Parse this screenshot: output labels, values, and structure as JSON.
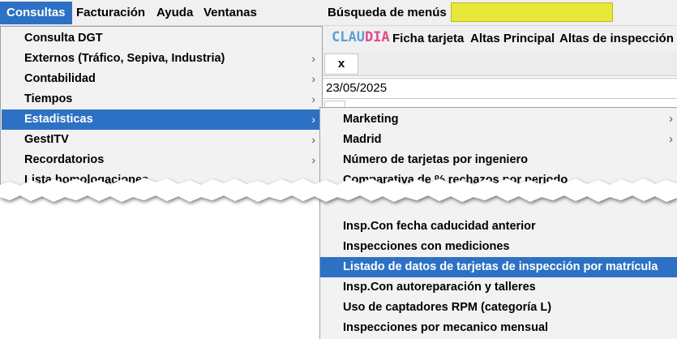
{
  "menubar": {
    "items": [
      "Consultas",
      "Facturación",
      "Ayuda",
      "Ventanas"
    ],
    "search_label": "Búsqueda de menús",
    "search_value": ""
  },
  "toolbar": {
    "logo_part1": "CLAU",
    "logo_part2": "DIA",
    "items": [
      "Ficha tarjeta",
      "Altas Principal",
      "Altas de inspección"
    ]
  },
  "tab": {
    "close_label": "x"
  },
  "date": "23/05/2025",
  "dropdown": {
    "items": [
      {
        "label": "Consulta DGT",
        "submenu": false
      },
      {
        "label": "Externos (Tráfico, Sepiva, Industria)",
        "submenu": true
      },
      {
        "label": "Contabilidad",
        "submenu": true
      },
      {
        "label": "Tiempos",
        "submenu": true
      },
      {
        "label": "Estadisticas",
        "submenu": true
      },
      {
        "label": "GestITV",
        "submenu": true
      },
      {
        "label": "Recordatorios",
        "submenu": true
      },
      {
        "label": "Lista homologaciones",
        "submenu": false
      }
    ],
    "arrow": "›"
  },
  "submenu": {
    "items": [
      {
        "label": "Marketing",
        "submenu": true
      },
      {
        "label": "Madrid",
        "submenu": true
      },
      {
        "label": "Número de tarjetas por ingeniero",
        "submenu": false
      },
      {
        "label": "Comparativa de % rechazos por periodo",
        "submenu": false
      },
      {
        "label": "Insp.Con fecha caducidad anterior",
        "submenu": false
      },
      {
        "label": "Inspecciones con mediciones",
        "submenu": false
      },
      {
        "label": "Listado de datos de tarjetas de inspección por matrícula",
        "submenu": false
      },
      {
        "label": "Insp.Con autoreparación y talleres",
        "submenu": false
      },
      {
        "label": "Uso de captadores RPM (categoría L)",
        "submenu": false
      },
      {
        "label": "Inspecciones por mecanico mensual",
        "submenu": false
      }
    ],
    "arrow": "›"
  },
  "colors": {
    "highlight": "#2d71c4",
    "search_box": "#e8e83a",
    "logo_blue": "#5aa0d8",
    "logo_pink": "#e24a8c"
  }
}
